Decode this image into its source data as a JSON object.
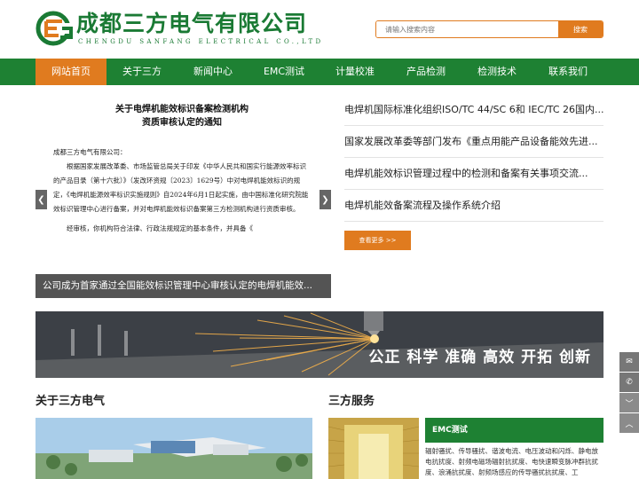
{
  "header": {
    "brand_cn": "成都三方电气有限公司",
    "brand_en": "CHENGDU SANFANG ELECTRICAL CO.,LTD",
    "search_placeholder": "请输入搜索内容",
    "search_button": "搜索"
  },
  "nav": [
    {
      "label": "网站首页",
      "active": true
    },
    {
      "label": "关于三方",
      "active": false
    },
    {
      "label": "新闻中心",
      "active": false
    },
    {
      "label": "EMC测试",
      "active": false
    },
    {
      "label": "计量校准",
      "active": false
    },
    {
      "label": "产品检测",
      "active": false
    },
    {
      "label": "检测技术",
      "active": false
    },
    {
      "label": "联系我们",
      "active": false
    }
  ],
  "slider": {
    "doc_title_1": "关于电焊机能效标识备案检测机构",
    "doc_title_2": "资质审核认定的通知",
    "doc_salute": "成都三方电气有限公司：",
    "doc_body": "根据国家发展改革委、市场监管总局关于印发《中华人民共和国实行能源效率标识的产品目录（第十六批）》（发改环资规〔2023〕1629号）中对电焊机能效标识的规定，《电焊机能源效率标识实施规则》自2024年6月1日起实施，由中国标准化研究院能效标识管理中心进行备案，并对电焊机能效标识备案第三方检测机构进行资质审核。",
    "doc_p2": "经审核，你机构符合法律、行政法规规定的基本条件，并具备《",
    "caption": "公司成为首家通过全国能效标识管理中心审核认定的电焊机能效..."
  },
  "news": [
    "电焊机国际标准化组织ISO/TC 44/SC 6和 IEC/TC 26国内...",
    "国家发展改革委等部门发布《重点用能产品设备能效先进...",
    "电焊机能效标识管理过程中的检测和备案有关事项交流...",
    "电焊机能效备案流程及操作系统介绍"
  ],
  "more_button": "查看更多 >>",
  "banner": {
    "slogan": "公正  科学  准确  高效  开拓  创新"
  },
  "about": {
    "title": "关于三方电气"
  },
  "services": {
    "title": "三方服务",
    "tab_label": "EMC测试",
    "description": "辐射骚扰、传导骚扰、谐波电流、电压波动和闪烁、静电放电抗扰度、射频电磁场辐射抗扰度、电快速瞬变脉冲群抗扰度、浪涌抗扰度、射频场感应的传导骚扰抗扰度、工"
  },
  "side_tools": {
    "mail_icon": "envelope-icon",
    "phone_icon": "phone-icon",
    "down_icon": "chevron-down-icon",
    "up_icon": "chevron-up-icon",
    "mail_glyph": "✉",
    "phone_glyph": "✆",
    "down_glyph": "﹀",
    "up_glyph": "︿"
  },
  "colors": {
    "brand_green": "#1e8133",
    "accent_orange": "#e07b1f"
  }
}
